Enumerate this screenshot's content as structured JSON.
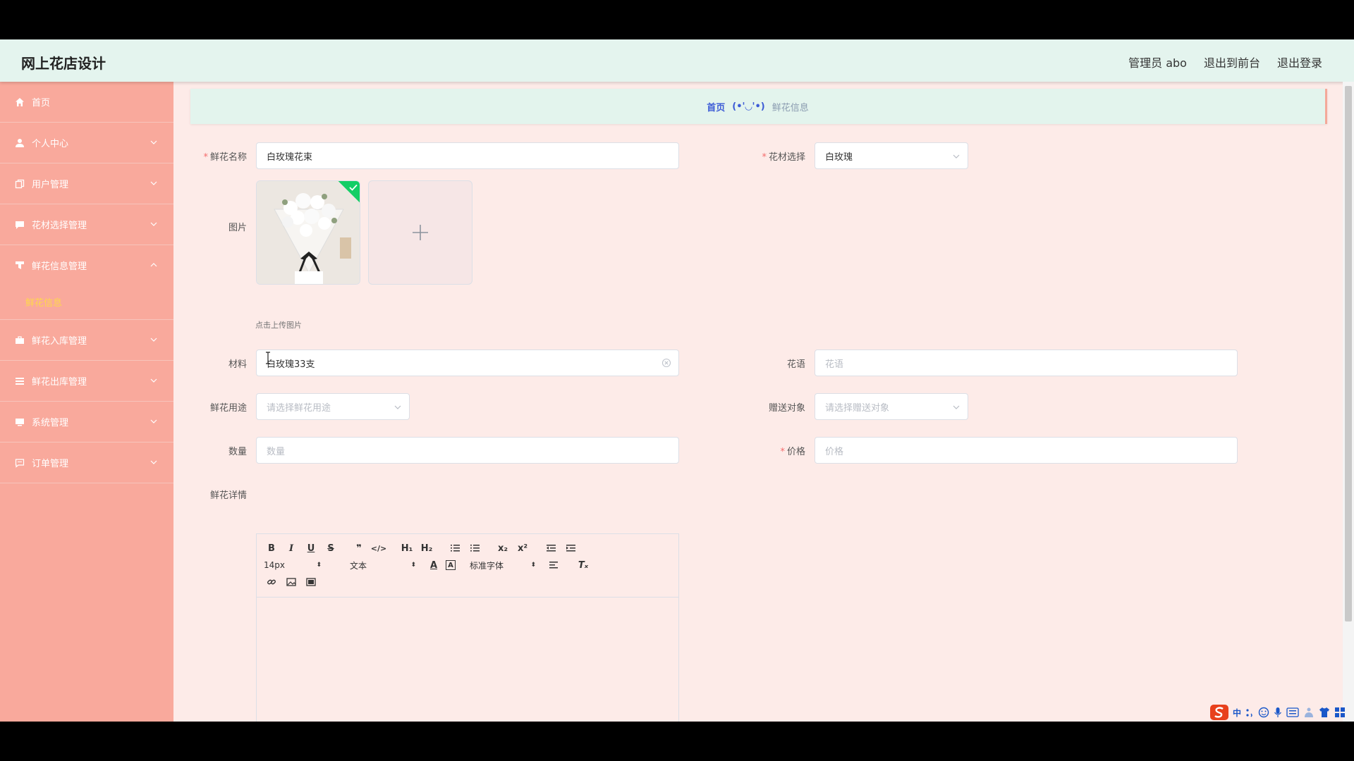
{
  "header": {
    "title": "网上花店设计",
    "admin": "管理员 abo",
    "to_front": "退出到前台",
    "logout": "退出登录"
  },
  "sidebar": {
    "items": [
      {
        "label": "首页",
        "icon": "home-icon"
      },
      {
        "label": "个人中心",
        "icon": "user-icon"
      },
      {
        "label": "用户管理",
        "icon": "copy-icon"
      },
      {
        "label": "花材选择管理",
        "icon": "comment-icon"
      },
      {
        "label": "鲜花信息管理",
        "icon": "filter-icon",
        "open": true,
        "children": [
          "鲜花信息"
        ]
      },
      {
        "label": "鲜花入库管理",
        "icon": "briefcase-icon"
      },
      {
        "label": "鲜花出库管理",
        "icon": "list-icon"
      },
      {
        "label": "系统管理",
        "icon": "monitor-icon"
      },
      {
        "label": "订单管理",
        "icon": "message-icon"
      }
    ]
  },
  "breadcrumb": {
    "home": "首页",
    "separator": "(•'◡'•)",
    "current": "鲜花信息"
  },
  "form": {
    "name_label": "鲜花名称",
    "name_value": "白玫瑰花束",
    "material_select_label": "花材选择",
    "material_select_value": "白玫瑰",
    "image_label": "图片",
    "upload_hint": "点击上传图片",
    "material_label": "材料",
    "material_value": "白玫瑰33支",
    "flower_language_label": "花语",
    "flower_language_placeholder": "花语",
    "usage_label": "鲜花用途",
    "usage_placeholder": "请选择鲜花用途",
    "recipient_label": "赠送对象",
    "recipient_placeholder": "请选择赠送对象",
    "quantity_label": "数量",
    "quantity_placeholder": "数量",
    "price_label": "价格",
    "price_placeholder": "价格",
    "detail_label": "鲜花详情"
  },
  "editor": {
    "font_size": "14px",
    "text_style": "文本",
    "font_family": "标准字体"
  },
  "ime": {
    "mode": "中"
  },
  "colors": {
    "header_bg": "#e4f4ee",
    "sidebar_bg": "#f9a99c",
    "content_bg": "#fdebe8",
    "submenu_active": "#ffd84a",
    "breadcrumb_link": "#3c5bd6",
    "required": "#f56c6c"
  }
}
